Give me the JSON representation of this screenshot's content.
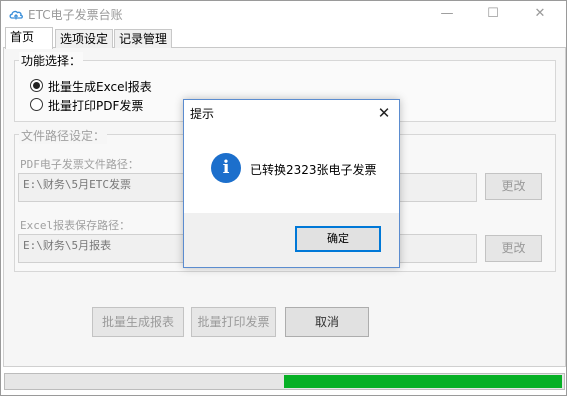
{
  "window": {
    "title": "ETC电子发票台账",
    "minimize_glyph": "—",
    "maximize_glyph": "☐",
    "close_glyph": "✕"
  },
  "tabs": [
    {
      "label": "首页",
      "active": true
    },
    {
      "label": "选项设定",
      "active": false
    },
    {
      "label": "记录管理",
      "active": false
    }
  ],
  "function_group": {
    "legend": "功能选择：",
    "options": [
      {
        "label": "批量生成Excel报表",
        "selected": true
      },
      {
        "label": "批量打印PDF发票",
        "selected": false
      }
    ]
  },
  "path_group": {
    "legend": "文件路径设定：",
    "pdf_label": "PDF电子发票文件路径：",
    "pdf_path": "E:\\财务\\5月ETC发票",
    "excel_label": "Excel报表保存路径：",
    "excel_path": "E:\\财务\\5月报表",
    "change_label": "更改"
  },
  "actions": {
    "generate_label": "批量生成报表",
    "print_label": "批量打印发票",
    "cancel_label": "取消"
  },
  "progress": {
    "fraction": 0.5
  },
  "dialog": {
    "title": "提示",
    "message": "已转换2323张电子发票",
    "icon": "info-icon",
    "icon_glyph": "i",
    "ok_label": "确定",
    "close_glyph": "✕"
  },
  "colors": {
    "progress_green": "#06b025",
    "info_blue": "#1c6fcc",
    "dialog_border": "#5b8ccf"
  }
}
